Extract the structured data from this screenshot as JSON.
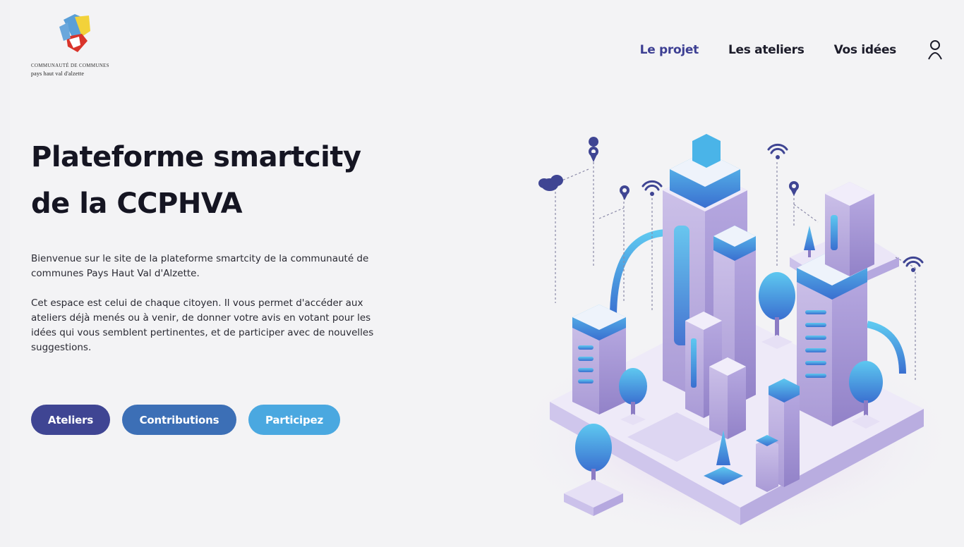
{
  "logo": {
    "line1": "communauté de communes",
    "line2": "pays haut val d'alzette"
  },
  "nav": {
    "items": [
      {
        "label": "Le projet",
        "active": true
      },
      {
        "label": "Les ateliers",
        "active": false
      },
      {
        "label": "Vos idées",
        "active": false
      }
    ],
    "user_icon": "user-icon"
  },
  "hero": {
    "title_line1": "Plateforme smartcity",
    "title_line2": "de la CCPHVA",
    "paragraph1": "Bienvenue sur le site de la plateforme smartcity de la communauté de communes Pays Haut Val d'Alzette.",
    "paragraph2": "Cet espace est celui de chaque citoyen. Il vous permet d'accéder aux ateliers déjà menés ou à venir, de donner votre avis en votant pour les idées qui vous semblent pertinentes, et de participer avec de nouvelles suggestions."
  },
  "buttons": {
    "ateliers": "Ateliers",
    "contributions": "Contributions",
    "participez": "Participez"
  },
  "colors": {
    "nav_active": "#3d3f93",
    "btn_ateliers": "#3f4593",
    "btn_contributions": "#3c6fb6",
    "btn_participez": "#4aa8e0"
  },
  "illustration": "isometric-smart-city-illustration"
}
